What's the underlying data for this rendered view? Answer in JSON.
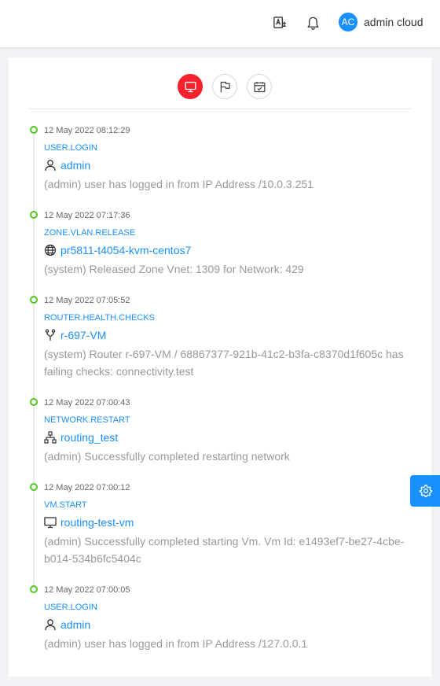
{
  "header": {
    "translate_icon": "translate-icon",
    "notification_icon": "bell-icon",
    "user": {
      "initials": "AC",
      "name": "admin cloud"
    }
  },
  "tabs": [
    {
      "icon": "desktop-icon",
      "active": true
    },
    {
      "icon": "flag-icon",
      "active": false
    },
    {
      "icon": "calendar-check-icon",
      "active": false
    }
  ],
  "events": [
    {
      "time": "12 May 2022 08:12:29",
      "type": "USER.LOGIN",
      "resource_icon": "user-icon",
      "resource": "admin",
      "description": "(admin) user has logged in from IP Address /10.0.3.251"
    },
    {
      "time": "12 May 2022 07:17:36",
      "type": "ZONE.VLAN.RELEASE",
      "resource_icon": "globe-icon",
      "resource": "pr5811-t4054-kvm-centos7",
      "description": "(system) Released Zone Vnet: 1309 for Network: 429"
    },
    {
      "time": "12 May 2022 07:05:52",
      "type": "ROUTER.HEALTH.CHECKS",
      "resource_icon": "fork-icon",
      "resource": "r-697-VM",
      "description": "(system) Router r-697-VM / 68867377-921b-41c2-b3fa-c8370d1f605c has failing checks: connectivity.test"
    },
    {
      "time": "12 May 2022 07:00:43",
      "type": "NETWORK.RESTART",
      "resource_icon": "network-icon",
      "resource": "routing_test",
      "description": "(admin) Successfully completed restarting network"
    },
    {
      "time": "12 May 2022 07:00:12",
      "type": "VM.START",
      "resource_icon": "desktop-icon",
      "resource": "routing-test-vm",
      "description": "(admin) Successfully completed starting Vm. Vm Id: e1493ef7-be27-4cbe-b014-534b6fc5404c"
    },
    {
      "time": "12 May 2022 07:00:05",
      "type": "USER.LOGIN",
      "resource_icon": "user-icon",
      "resource": "admin",
      "description": "(admin) user has logged in from IP Address /127.0.0.1"
    }
  ],
  "settings_icon": "gear-icon",
  "colors": {
    "primary": "#1890ff",
    "active_tab": "#f5222d",
    "timeline_dot": "#52c41a",
    "muted_text": "#999999"
  }
}
